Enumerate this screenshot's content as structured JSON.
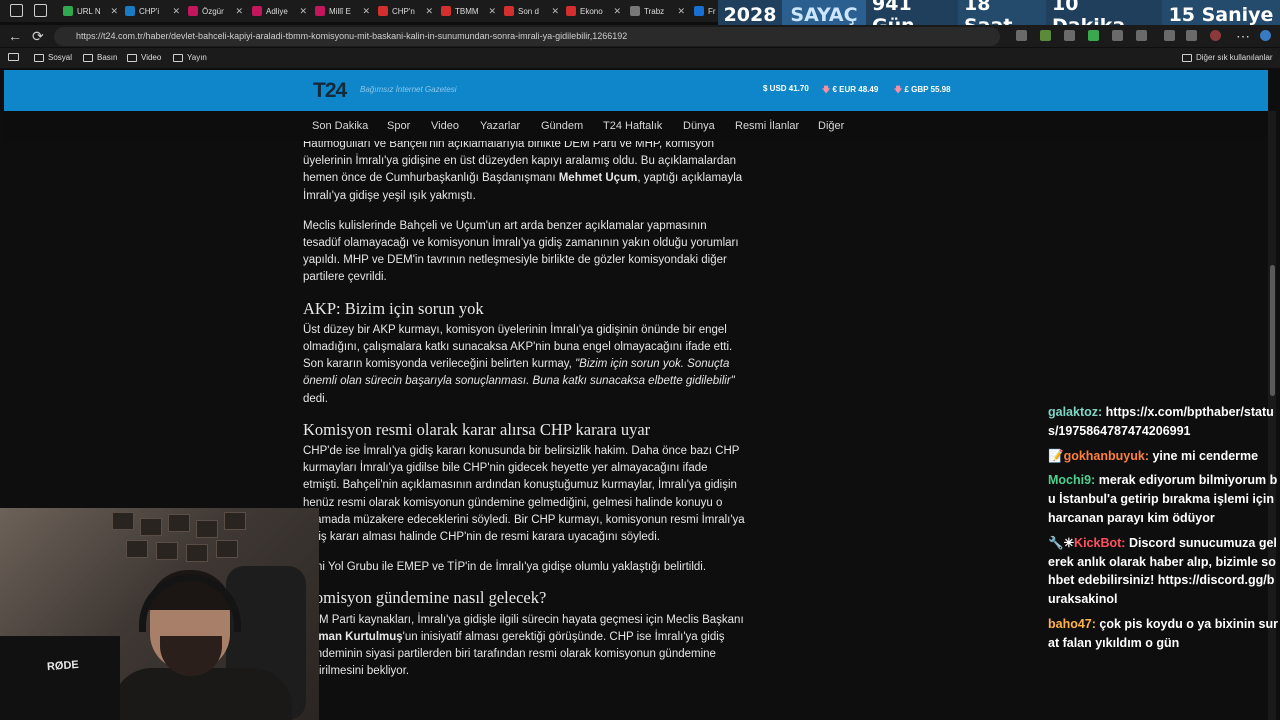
{
  "browser": {
    "tabs": [
      {
        "title": "URL N",
        "color": "#2fa84f"
      },
      {
        "title": "CHP'i",
        "color": "#1a7ac2"
      },
      {
        "title": "Özgür",
        "color": "#c2185b"
      },
      {
        "title": "Adliye",
        "color": "#c2185b"
      },
      {
        "title": "Millî E",
        "color": "#c2185b"
      },
      {
        "title": "CHP'n",
        "color": "#d32f2f"
      },
      {
        "title": "TBMM",
        "color": "#d32f2f"
      },
      {
        "title": "Son d",
        "color": "#d32f2f"
      },
      {
        "title": "Ekono",
        "color": "#d32f2f"
      },
      {
        "title": "Trabz",
        "color": "#777777"
      },
      {
        "title": "Fr",
        "color": "#1a6fd3"
      }
    ],
    "url": "https://t24.com.tr/haber/devlet-bahceli-kapiyi-araladi-tbmm-komisyonu-mit-baskani-kalin-in-sunumundan-sonra-imrali-ya-gidilebilir,1266192",
    "bookmarks": [
      "Sosyal",
      "Basın",
      "Video",
      "Yayın"
    ],
    "other_bookmarks": "Diğer sık kullanılanlar"
  },
  "counter": {
    "year": "2028",
    "label": "SAYAÇ",
    "days": "941 Gün",
    "hours": "18 Saat",
    "minutes": "10 Dakika",
    "seconds": "15 Saniye"
  },
  "site": {
    "logo": "T24",
    "tagline": "Bağımsız İnternet Gazetesi",
    "currency": {
      "usd": "$ USD 41.70",
      "eur": "€ EUR 48.49",
      "gbp": "£ GBP 55.98",
      "down_arrow": "🡇"
    },
    "nav": [
      "Son Dakika",
      "Spor",
      "Video",
      "Yazarlar",
      "Gündem",
      "T24 Haftalık",
      "Dünya",
      "Resmi İlanlar",
      "Diğer"
    ]
  },
  "article": {
    "p1a": "Hatimoğulları ve Bahçeli'nin açıklamalarıyla birlikte DEM Parti ve MHP, komisyon üyelerinin İmralı'ya gidişine en üst düzeyden kapıyı aralamış oldu. Bu açıklamalardan hemen önce de Cumhurbaşkanlığı Başdanışmanı ",
    "p1b": "Mehmet Uçum",
    "p1c": ", yaptığı açıklamayla İmralı'ya gidişe yeşil ışık yakmıştı.",
    "p2": "Meclis kulislerinde Bahçeli ve Uçum'un art arda benzer açıklamalar yapmasının tesadüf olamayacağı ve komisyonun İmralı'ya gidiş zamanının yakın olduğu yorumları yapıldı. MHP ve DEM'in tavrının netleşmesiyle birlikte de gözler komisyondaki diğer partilere çevrildi.",
    "h1": "AKP: Bizim için sorun yok",
    "p3a": "Üst düzey bir AKP kurmayı, komisyon üyelerinin İmralı'ya gidişinin önünde bir engel olmadığını, çalışmalara katkı sunacaksa AKP'nin buna engel olmayacağını ifade etti. Son kararın komisyonda verileceğini belirten kurmay, ",
    "p3b": "\"Bizim için sorun yok. Sonuçta önemli olan sürecin başarıyla sonuçlanması. Buna katkı sunacaksa elbette gidilebilir\"",
    "p3c": " dedi.",
    "h2": "Komisyon resmi olarak karar alırsa CHP karara uyar",
    "p4": "CHP'de ise İmralı'ya gidiş kararı konusunda bir belirsizlik hakim. Daha önce bazı CHP kurmayları İmralı'ya gidilse bile CHP'nin gidecek heyette yer almayacağını ifade etmişti. Bahçeli'nin açıklamasının ardından konuştuğumuz kurmaylar, İmralı'ya gidişin henüz resmi olarak komisyonun gündemine gelmediğini, gelmesi halinde konuyu o aşamada müzakere edeceklerini söyledi. Bir CHP kurmayı, komisyonun resmi İmralı'ya gidiş kararı alması halinde CHP'nin de resmi karara uyacağını söyledi.",
    "p5": "Yeni Yol Grubu ile EMEP ve TİP'in de İmralı'ya gidişe olumlu yaklaştığı belirtildi.",
    "h3": "Komisyon gündemine nasıl gelecek?",
    "p6a": "DEM Parti kaynakları, İmralı'ya gidişle ilgili sürecin hayata geçmesi için Meclis Başkanı ",
    "p6b": "Numan Kurtulmuş",
    "p6c": "'un inisiyatif alması gerektiği görüşünde. CHP ise İmralı'ya gidiş gündeminin siyasi partilerden biri tarafından resmi olarak komisyonun gündemine getirilmesini bekliyor."
  },
  "chat": [
    {
      "user": "galaktoz:",
      "color": "#7fd6c4",
      "badge": "",
      "text": "https://x.com/bpthaber/status/1975864787474206991"
    },
    {
      "user": "gokhanbuyuk:",
      "color": "#ff7f3f",
      "badge": "📝",
      "text": "yine mi cenderme"
    },
    {
      "user": "Mochi9:",
      "color": "#4fcf8e",
      "badge": "",
      "text": "merak ediyorum bilmiyorum bu İstanbul'a getirip bırakma işlemi için harcanan parayı kim ödüyor"
    },
    {
      "user": "KickBot:",
      "color": "#ff4f5f",
      "badge": "🔧✳",
      "text": "Discord sunucumuza gelerek anlık olarak haber alıp, bizimle sohbet edebilirsiniz! https://discord.gg/buraksakinol"
    },
    {
      "user": "baho47:",
      "color": "#ffb347",
      "badge": "",
      "text": "çok pis koydu o ya bixinin surat falan yıkıldım o gün"
    }
  ],
  "webcam": {
    "mic_brand": "RØDE"
  }
}
